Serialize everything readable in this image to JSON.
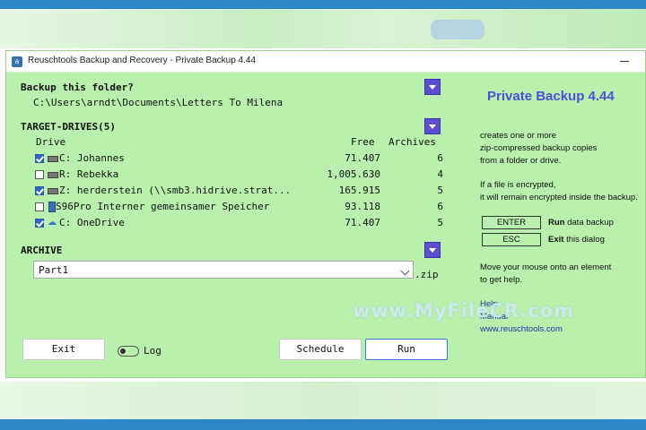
{
  "window": {
    "title": "Reuschtools Backup and Recovery - Private Backup 4.44"
  },
  "backup_folder": {
    "heading": "Backup this folder?",
    "path": "C:\\Users\\arndt\\Documents\\Letters To Milena"
  },
  "target_drives": {
    "heading": "TARGET-DRIVES(5)",
    "columns": {
      "drive": "Drive",
      "free": "Free",
      "archives": "Archives"
    },
    "rows": [
      {
        "checked": true,
        "icon": "hard-drive-icon",
        "label": "C:  Johannes",
        "free": "71.407",
        "archives": "6"
      },
      {
        "checked": false,
        "icon": "hard-drive-icon",
        "label": "R:  Rebekka",
        "free": "1,005.630",
        "archives": "4"
      },
      {
        "checked": true,
        "icon": "network-drive-icon",
        "label": "Z:  herderstein (\\\\smb3.hidrive.strat...",
        "free": "165.915",
        "archives": "5"
      },
      {
        "checked": false,
        "icon": "phone-icon",
        "label": "S96Pro Interner gemeinsamer Speicher",
        "free": "93.118",
        "archives": "6"
      },
      {
        "checked": true,
        "icon": "onedrive-icon",
        "label": "C:  OneDrive",
        "free": "71.407",
        "archives": "5"
      }
    ]
  },
  "archive": {
    "heading": "ARCHIVE",
    "value": "Part1",
    "extension": ".zip"
  },
  "buttons": {
    "exit": "Exit",
    "log": "Log",
    "schedule": "Schedule",
    "run": "Run"
  },
  "info": {
    "title": "Private Backup 4.44",
    "desc1": "creates one or more",
    "desc2": "zip-compressed backup copies",
    "desc3": "from a folder or drive.",
    "enc1": "If a file is encrypted,",
    "enc2": "it will remain encrypted inside the backup.",
    "keys": [
      {
        "key": "ENTER",
        "bold": "Run",
        "rest": " data backup"
      },
      {
        "key": "ESC",
        "bold": "Exit",
        "rest": " this dialog"
      }
    ],
    "mouse1": "Move your mouse onto an element",
    "mouse2": "to get help.",
    "help": "Help",
    "manual": "Manual",
    "website": "www.reuschtools.com"
  },
  "watermark": "www.MyFileCR.com",
  "colors": {
    "window_bg": "#b9f0ad",
    "accent_purple": "#5b4fd0",
    "title_blue": "#4a52d6",
    "check_blue": "#2f66c8",
    "desktop_blue": "#2f86c6"
  }
}
